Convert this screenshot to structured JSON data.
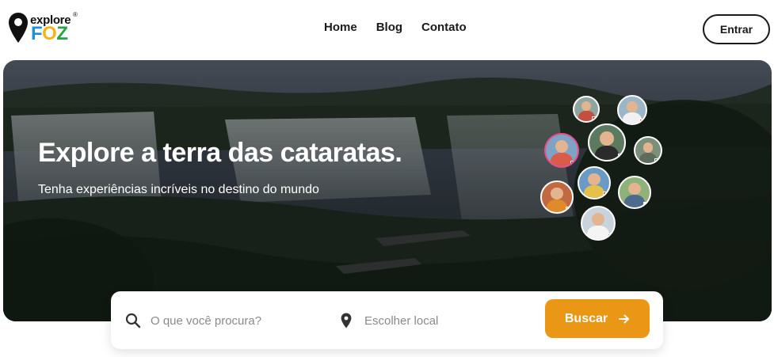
{
  "brand": {
    "logo_top": "explore",
    "logo_bottom_parts": [
      "F",
      "O",
      "Z"
    ],
    "logo_mark": "®",
    "colors": {
      "f": "#1e8fd6",
      "o": "#f2b31b",
      "z": "#2aa24a"
    }
  },
  "nav": {
    "items": [
      {
        "label": "Home"
      },
      {
        "label": "Blog"
      },
      {
        "label": "Contato"
      }
    ]
  },
  "header": {
    "login_label": "Entrar"
  },
  "hero": {
    "title": "Explore a terra das cataratas.",
    "subtitle": "Tenha experiências incríveis no destino do mundo"
  },
  "search": {
    "query_placeholder": "O que você procura?",
    "location_placeholder": "Escolher local",
    "button_label": "Buscar",
    "button_icon": "arrow-right-icon",
    "accent": "#eb9716"
  }
}
